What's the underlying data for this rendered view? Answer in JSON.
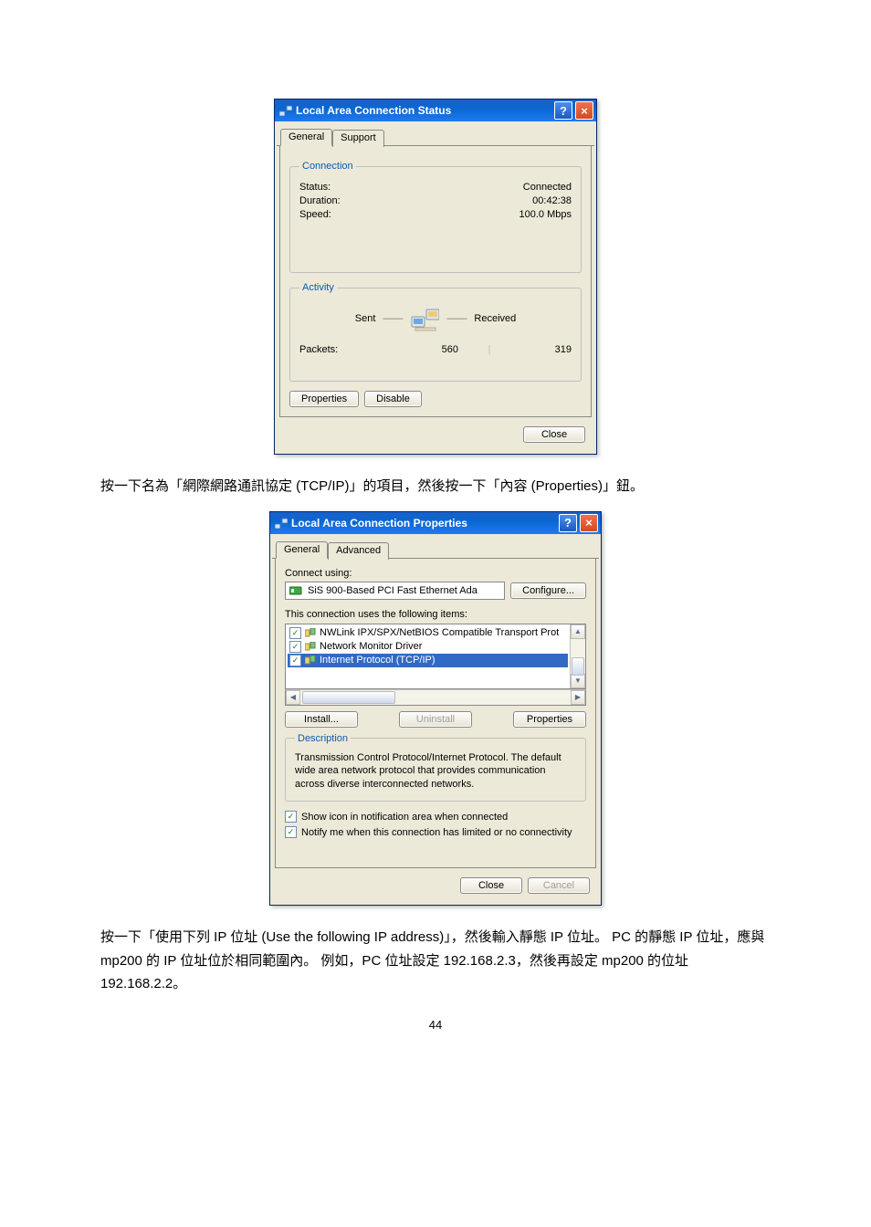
{
  "status_dialog": {
    "title": "Local Area Connection Status",
    "tabs": {
      "general": "General",
      "support": "Support"
    },
    "connection_group": "Connection",
    "status_label": "Status:",
    "status_value": "Connected",
    "duration_label": "Duration:",
    "duration_value": "00:42:38",
    "speed_label": "Speed:",
    "speed_value": "100.0 Mbps",
    "activity_group": "Activity",
    "sent_label": "Sent",
    "received_label": "Received",
    "packets_label": "Packets:",
    "packets_sent": "560",
    "packets_received": "319",
    "properties_btn": "Properties",
    "disable_btn": "Disable",
    "close_btn": "Close"
  },
  "paragraph1": "按一下名為「網際網路通訊協定 (TCP/IP)」的項目，然後按一下「內容 (Properties)」鈕。",
  "props_dialog": {
    "title": "Local Area Connection Properties",
    "tabs": {
      "general": "General",
      "advanced": "Advanced"
    },
    "connect_using_label": "Connect using:",
    "adapter_name": "SiS 900-Based PCI Fast Ethernet Ada",
    "configure_btn": "Configure...",
    "items_label": "This connection uses the following items:",
    "item1": "NWLink IPX/SPX/NetBIOS Compatible Transport Prot",
    "item2": "Network Monitor Driver",
    "item3": "Internet Protocol (TCP/IP)",
    "install_btn": "Install...",
    "uninstall_btn": "Uninstall",
    "properties_btn": "Properties",
    "description_group": "Description",
    "description_text": "Transmission Control Protocol/Internet Protocol. The default wide area network protocol that provides communication across diverse interconnected networks.",
    "show_icon_label": "Show icon in notification area when connected",
    "notify_label": "Notify me when this connection has limited or no connectivity",
    "close_btn": "Close",
    "cancel_btn": "Cancel"
  },
  "paragraph2": "按一下「使用下列 IP 位址 (Use the following IP address)」，然後輸入靜態 IP 位址。 PC 的靜態 IP 位址，應與 mp200 的 IP 位址位於相同範圍內。 例如，PC 位址設定 192.168.2.3，然後再設定 mp200 的位址 192.168.2.2。",
  "page_number": "44"
}
